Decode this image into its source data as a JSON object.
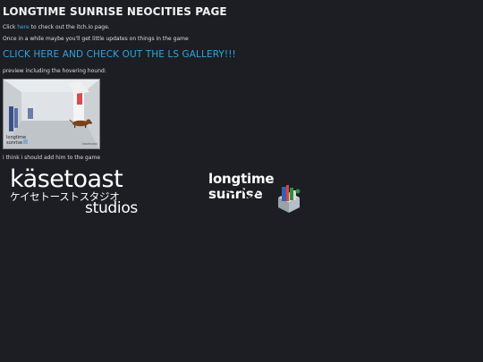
{
  "title": "LONGTIME SUNRISE NEOCITIES PAGE",
  "intro": {
    "prefix": "Click ",
    "link": "here",
    "suffix": " to check out the itch.io page."
  },
  "updates_line": "Once in a while maybe you'll get little updates on things in the game",
  "gallery_link": "CLICK HERE AND CHECK OUT THE LS GALLERY!!!",
  "preview_caption": "preview including the hovering hound:",
  "preview_image": {
    "logo_line1": "longtime",
    "logo_line2": "sunrise",
    "corner_text": "kasetoast"
  },
  "after_caption": "i think i should add him to the game",
  "logos": {
    "kasetoast": {
      "word": "käsetoast",
      "kana": "ケイセトーストスタジオ",
      "studios": "studios"
    },
    "longtime_sunrise": {
      "line1": "longtime",
      "line2": "sunrise"
    }
  }
}
